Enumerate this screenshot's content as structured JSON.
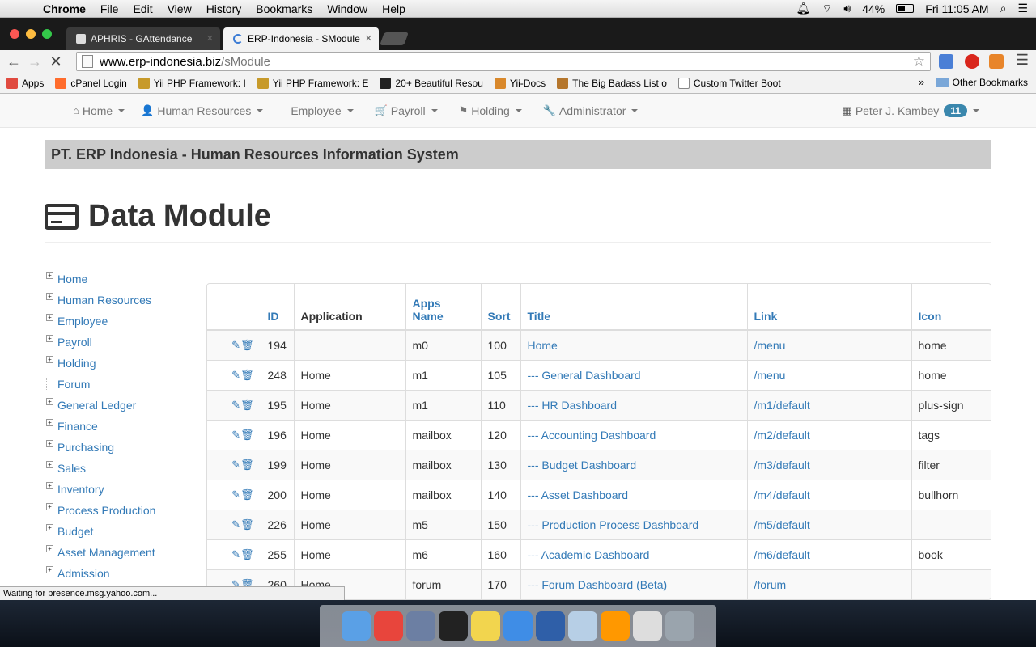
{
  "macos": {
    "app_name": "Chrome",
    "menus": [
      "File",
      "Edit",
      "View",
      "History",
      "Bookmarks",
      "Window",
      "Help"
    ],
    "battery": "44%",
    "clock": "Fri 11:05 AM"
  },
  "browser": {
    "tabs": [
      {
        "title": "APHRIS - GAttendance",
        "active": false
      },
      {
        "title": "ERP-Indonesia - SModule",
        "active": true
      }
    ],
    "url_host": "www.erp-indonesia.biz",
    "url_path": "/sModule",
    "bookmarks": [
      {
        "label": "Apps",
        "icon_color": "#e04a3f"
      },
      {
        "label": "cPanel Login",
        "icon_color": "#ff6c2c"
      },
      {
        "label": "Yii PHP Framework: I",
        "icon_color": "#c79a2a"
      },
      {
        "label": "Yii PHP Framework: E",
        "icon_color": "#c79a2a"
      },
      {
        "label": "20+ Beautiful Resou",
        "icon_color": "#222222"
      },
      {
        "label": "Yii-Docs",
        "icon_color": "#d9882b"
      },
      {
        "label": "The Big Badass List o",
        "icon_color": "#b5762c"
      },
      {
        "label": "Custom Twitter Boot",
        "icon_color": "#ffffff"
      }
    ],
    "bookmarks_more": "»",
    "other_bookmarks": "Other Bookmarks",
    "status_text": "Waiting for presence.msg.yahoo.com..."
  },
  "navbar": {
    "items": [
      {
        "label": "Home",
        "icon": "home-icon",
        "glyph": "⌂"
      },
      {
        "label": "Human Resources",
        "icon": "user-icon",
        "glyph": "👤"
      },
      {
        "label": "Employee",
        "icon": "",
        "glyph": ""
      },
      {
        "label": "Payroll",
        "icon": "cart-icon",
        "glyph": "🛒"
      },
      {
        "label": "Holding",
        "icon": "flag-icon",
        "glyph": "⚑"
      },
      {
        "label": "Administrator",
        "icon": "wrench-icon",
        "glyph": "🔧"
      }
    ],
    "user": {
      "name": "Peter J. Kambey",
      "badge": "11"
    }
  },
  "banner": "PT. ERP Indonesia - Human Resources Information System",
  "page_title": "Data Module",
  "sidebar": {
    "items": [
      {
        "label": "Home",
        "expandable": true
      },
      {
        "label": "Human Resources",
        "expandable": true
      },
      {
        "label": "Employee",
        "expandable": true
      },
      {
        "label": "Payroll",
        "expandable": true
      },
      {
        "label": "Holding",
        "expandable": true
      },
      {
        "label": "Forum",
        "expandable": false
      },
      {
        "label": "General Ledger",
        "expandable": true
      },
      {
        "label": "Finance",
        "expandable": true
      },
      {
        "label": "Purchasing",
        "expandable": true
      },
      {
        "label": "Sales",
        "expandable": true
      },
      {
        "label": "Inventory",
        "expandable": true
      },
      {
        "label": "Process Production",
        "expandable": true
      },
      {
        "label": "Budget",
        "expandable": true
      },
      {
        "label": "Asset Management",
        "expandable": true
      },
      {
        "label": "Admission",
        "expandable": true
      }
    ]
  },
  "table": {
    "columns": [
      {
        "label": "",
        "sortable": false
      },
      {
        "label": "ID",
        "sortable": true
      },
      {
        "label": "Application",
        "sortable": false
      },
      {
        "label": "Apps Name",
        "sortable": true
      },
      {
        "label": "Sort",
        "sortable": true
      },
      {
        "label": "Title",
        "sortable": true
      },
      {
        "label": "Link",
        "sortable": true
      },
      {
        "label": "Icon",
        "sortable": true
      }
    ],
    "rows": [
      {
        "id": "194",
        "application": "",
        "apps_name": "m0",
        "sort": "100",
        "title": "Home",
        "link": "/menu",
        "icon": "home"
      },
      {
        "id": "248",
        "application": "Home",
        "apps_name": "m1",
        "sort": "105",
        "title": "--- General Dashboard",
        "link": "/menu",
        "icon": "home"
      },
      {
        "id": "195",
        "application": "Home",
        "apps_name": "m1",
        "sort": "110",
        "title": "--- HR Dashboard",
        "link": "/m1/default",
        "icon": "plus-sign"
      },
      {
        "id": "196",
        "application": "Home",
        "apps_name": "mailbox",
        "sort": "120",
        "title": "--- Accounting Dashboard",
        "link": "/m2/default",
        "icon": "tags"
      },
      {
        "id": "199",
        "application": "Home",
        "apps_name": "mailbox",
        "sort": "130",
        "title": "--- Budget Dashboard",
        "link": "/m3/default",
        "icon": "filter"
      },
      {
        "id": "200",
        "application": "Home",
        "apps_name": "mailbox",
        "sort": "140",
        "title": "--- Asset Dashboard",
        "link": "/m4/default",
        "icon": "bullhorn"
      },
      {
        "id": "226",
        "application": "Home",
        "apps_name": "m5",
        "sort": "150",
        "title": "--- Production Process Dashboard",
        "link": "/m5/default",
        "icon": ""
      },
      {
        "id": "255",
        "application": "Home",
        "apps_name": "m6",
        "sort": "160",
        "title": "--- Academic Dashboard",
        "link": "/m6/default",
        "icon": "book"
      },
      {
        "id": "260",
        "application": "Home",
        "apps_name": "forum",
        "sort": "170",
        "title": "--- Forum Dashboard (Beta)",
        "link": "/forum",
        "icon": ""
      }
    ]
  },
  "dock": [
    {
      "name": "finder-icon",
      "color": "#5aa0e6"
    },
    {
      "name": "chrome-icon",
      "color": "#e8453c"
    },
    {
      "name": "preview-icon",
      "color": "#6c7fa3"
    },
    {
      "name": "terminal-icon",
      "color": "#222222"
    },
    {
      "name": "stickies-icon",
      "color": "#f2d54e"
    },
    {
      "name": "itunes-icon",
      "color": "#3f8de6"
    },
    {
      "name": "virtualbox-icon",
      "color": "#2f5fa8"
    },
    {
      "name": "box-icon",
      "color": "#b7cfe6"
    },
    {
      "name": "sublime-icon",
      "color": "#ff9800"
    },
    {
      "name": "sql-file-icon",
      "color": "#dddddd"
    },
    {
      "name": "trash-icon",
      "color": "#9aa4ad"
    }
  ]
}
